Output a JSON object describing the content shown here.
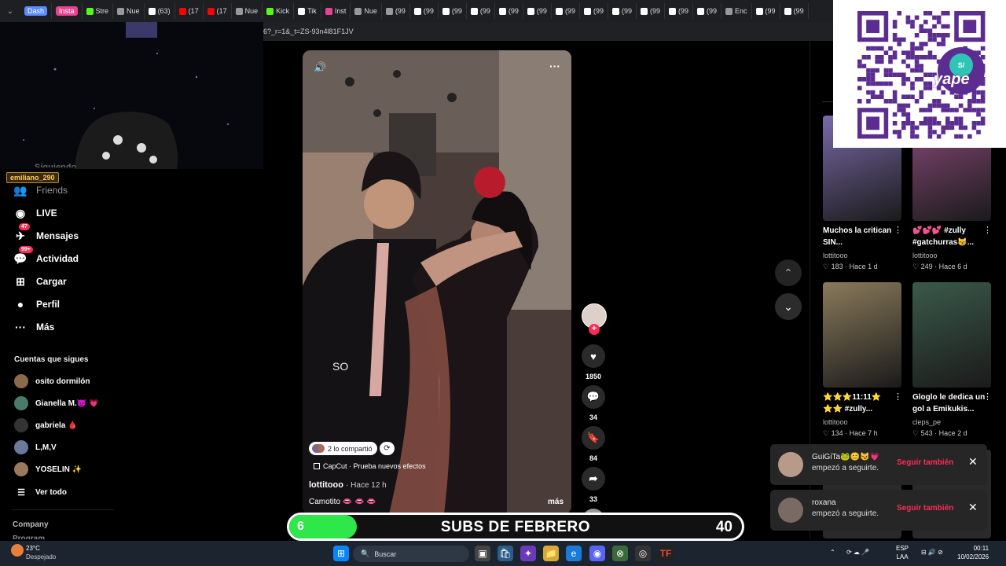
{
  "browser": {
    "tabs": [
      {
        "label": "Dash",
        "color": "#5b8cff",
        "pill": true
      },
      {
        "label": "Insta",
        "color": "#e84393",
        "pill": true
      },
      {
        "label": "Stre",
        "icon": "kick-icon",
        "color": "#53fc18"
      },
      {
        "label": "Nue",
        "icon": "page-icon",
        "color": "#999999"
      },
      {
        "label": "(63)",
        "icon": "tiktok-icon",
        "color": "#ffffff"
      },
      {
        "label": "(17",
        "icon": "youtube-icon",
        "color": "#ff0000"
      },
      {
        "label": "(17",
        "icon": "youtube-icon",
        "color": "#ff0000"
      },
      {
        "label": "Nue",
        "icon": "page-icon",
        "color": "#999999"
      },
      {
        "label": "Kick",
        "icon": "kick-icon",
        "color": "#53fc18"
      },
      {
        "label": "Tik",
        "icon": "tiktok-icon",
        "color": "#ffffff"
      },
      {
        "label": "Inst",
        "icon": "instagram-icon",
        "color": "#e84393"
      },
      {
        "label": "Nue",
        "icon": "page-icon",
        "color": "#999999"
      },
      {
        "label": "(99",
        "icon": "page-icon",
        "color": "#999999"
      },
      {
        "label": "(99",
        "icon": "tiktok-icon",
        "color": "#ffffff"
      },
      {
        "label": "(99",
        "icon": "tiktok-icon",
        "color": "#ffffff"
      },
      {
        "label": "(99",
        "icon": "tiktok-icon",
        "color": "#ffffff"
      },
      {
        "label": "(99",
        "icon": "tiktok-icon",
        "color": "#ffffff"
      },
      {
        "label": "(99",
        "icon": "tiktok-icon",
        "color": "#ffffff"
      },
      {
        "label": "(99",
        "icon": "tiktok-icon",
        "color": "#ffffff"
      },
      {
        "label": "(99",
        "icon": "tiktok-icon",
        "color": "#ffffff"
      },
      {
        "label": "(99",
        "icon": "tiktok-icon",
        "color": "#ffffff"
      },
      {
        "label": "(99",
        "icon": "tiktok-icon",
        "color": "#ffffff"
      },
      {
        "label": "(99",
        "icon": "tiktok-icon",
        "color": "#ffffff"
      },
      {
        "label": "(99",
        "icon": "tiktok-icon",
        "color": "#ffffff"
      },
      {
        "label": "Enc",
        "icon": "page-icon",
        "color": "#999999"
      },
      {
        "label": "(99",
        "icon": "tiktok-icon",
        "color": "#ffffff"
      },
      {
        "label": "(99",
        "icon": "tiktok-icon",
        "color": "#ffffff"
      }
    ],
    "address_fragment": "6?_r=1&_t=ZS-93n4l81F1JV"
  },
  "overlay": {
    "streamer_name": "emiliano_290",
    "hidden_item": "Siguiendo"
  },
  "sidebar": {
    "items": [
      {
        "label": "Friends",
        "icon": "friends-icon",
        "badge": ""
      },
      {
        "label": "LIVE",
        "icon": "live-icon",
        "badge": ""
      },
      {
        "label": "Mensajes",
        "icon": "messages-icon",
        "badge": "47"
      },
      {
        "label": "Actividad",
        "icon": "activity-icon",
        "badge": "99+"
      },
      {
        "label": "Cargar",
        "icon": "upload-icon",
        "badge": ""
      },
      {
        "label": "Perfil",
        "icon": "profile-icon",
        "badge": ""
      },
      {
        "label": "Más",
        "icon": "more-icon",
        "badge": ""
      }
    ],
    "following_title": "Cuentas que sigues",
    "following": [
      {
        "name": "osito dormilón",
        "color": "#8a6a4a"
      },
      {
        "name": "Gianella M.👿 💗",
        "color": "#4a7a6a"
      },
      {
        "name": "gabriela 🩸",
        "color": "#333333"
      },
      {
        "name": "L,M,V",
        "color": "#6a7a9a"
      },
      {
        "name": "YOSELIN ✨",
        "color": "#9a7a5a"
      }
    ],
    "see_all": "Ver todo",
    "company": "Company",
    "program": "Program"
  },
  "video": {
    "overlay_text": "SO",
    "shared_text": "2 lo compartió",
    "effect_text": "CapCut · Prueba nuevos efectos",
    "author": "lottitooo",
    "time": "· Hace 12 h",
    "caption": "Camotito 👄 👄 👄",
    "more": "más"
  },
  "actions": {
    "likes": "1850",
    "comments": "34",
    "saves": "84",
    "shares": "33"
  },
  "recommendations": [
    {
      "caption": "Muchos la critican SIN...",
      "user": "lottitooo",
      "likes": "183",
      "time": "Hace 1 d",
      "bg": "#7a6aa8"
    },
    {
      "caption": "💕💕💕 #zully #gatchurras😼...",
      "user": "lottitooo",
      "likes": "249",
      "time": "Hace 6 d",
      "bg": "#8a4a7a"
    },
    {
      "caption": "⭐⭐⭐11:11⭐ ⭐⭐ #zully...",
      "user": "lottitooo",
      "likes": "134",
      "time": "Hace 7 h",
      "bg": "#8a7a5a"
    },
    {
      "caption": "Gloglo le dedica un gol a Emikukis...",
      "user": "cleps_pe",
      "likes": "543",
      "time": "Hace 2 d",
      "bg": "#3a5a4a"
    }
  ],
  "notifications": [
    {
      "name": "GuiGiTa🐸😊😼💗",
      "text": "empezó a seguirte.",
      "action": "Seguir también"
    },
    {
      "name": "roxana",
      "text": "empezó a seguirte.",
      "action": "Seguir también"
    }
  ],
  "subs_goal": {
    "current": "6",
    "title": "SUBS DE FEBRERO",
    "goal": "40",
    "progress": 0.15
  },
  "qr": {
    "brand": "yape",
    "currency": "S/"
  },
  "taskbar": {
    "weather_temp": "23°C",
    "weather_desc": "Despejado",
    "search_placeholder": "Buscar",
    "lang_top": "ESP",
    "lang_bottom": "LAA",
    "time": "00:11",
    "date": "10/02/2026"
  },
  "colors": {
    "accent": "#fe2c55",
    "progress": "#2ee84a",
    "qr": "#5c2d91"
  }
}
